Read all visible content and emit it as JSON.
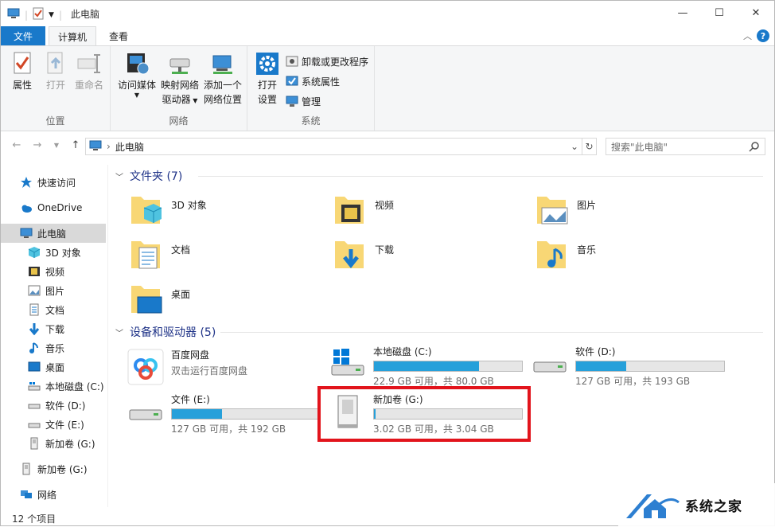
{
  "window": {
    "title": "此电脑",
    "controls": {
      "minimize": "—",
      "maximize": "☐",
      "close": "✕"
    }
  },
  "tabs": [
    {
      "label": "文件"
    },
    {
      "label": "计算机"
    },
    {
      "label": "查看"
    }
  ],
  "help": "?",
  "ribbon": {
    "location": {
      "label": "位置",
      "items": [
        "属性",
        "打开",
        "重命名"
      ]
    },
    "network": {
      "label": "网络",
      "access_media": "访问媒体",
      "map_drive_1": "映射网络",
      "map_drive_2": "驱动器",
      "add_location_1": "添加一个",
      "add_location_2": "网络位置"
    },
    "system": {
      "label": "系统",
      "open_settings_1": "打开",
      "open_settings_2": "设置",
      "uninstall": "卸载或更改程序",
      "sys_props": "系统属性",
      "manage": "管理"
    }
  },
  "address": {
    "path": "此电脑",
    "search_placeholder": "搜索\"此电脑\""
  },
  "sidebar": {
    "items": [
      {
        "label": "快速访问",
        "icon": "star-icon"
      },
      {
        "label": "OneDrive",
        "icon": "cloud-icon"
      },
      {
        "label": "此电脑",
        "icon": "computer-icon"
      },
      {
        "label": "3D 对象",
        "icon": "cube-icon"
      },
      {
        "label": "视频",
        "icon": "video-icon"
      },
      {
        "label": "图片",
        "icon": "picture-icon"
      },
      {
        "label": "文档",
        "icon": "document-icon"
      },
      {
        "label": "下载",
        "icon": "download-icon"
      },
      {
        "label": "音乐",
        "icon": "music-icon"
      },
      {
        "label": "桌面",
        "icon": "desktop-icon"
      },
      {
        "label": "本地磁盘 (C:)",
        "icon": "drive-icon"
      },
      {
        "label": "软件 (D:)",
        "icon": "drive-icon"
      },
      {
        "label": "文件 (E:)",
        "icon": "drive-icon"
      },
      {
        "label": "新加卷 (G:)",
        "icon": "usb-drive-icon"
      },
      {
        "label": "新加卷 (G:)",
        "icon": "usb-drive-icon"
      },
      {
        "label": "网络",
        "icon": "network-icon"
      }
    ]
  },
  "folders": {
    "heading": "文件夹 (7)",
    "items": [
      "3D 对象",
      "视频",
      "图片",
      "文档",
      "下载",
      "音乐",
      "桌面"
    ]
  },
  "devices": {
    "heading": "设备和驱动器 (5)",
    "items": [
      {
        "name": "百度网盘",
        "sub": "双击运行百度网盘"
      },
      {
        "name": "本地磁盘 (C:)",
        "free": "22.9 GB 可用，共 80.0 GB",
        "used_pct": 71
      },
      {
        "name": "软件 (D:)",
        "free": "127 GB 可用，共 193 GB",
        "used_pct": 34
      },
      {
        "name": "文件 (E:)",
        "free": "127 GB 可用，共 192 GB",
        "used_pct": 34
      },
      {
        "name": "新加卷 (G:)",
        "free": "3.02 GB 可用，共 3.04 GB",
        "used_pct": 1
      }
    ]
  },
  "status": {
    "count": "12 个项目"
  },
  "watermark": {
    "text": "系统之家"
  }
}
